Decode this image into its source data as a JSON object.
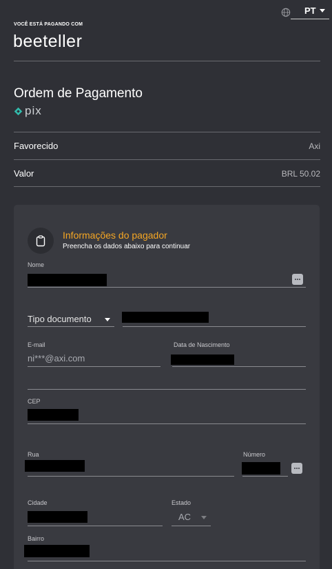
{
  "header": {
    "language": "PT",
    "paying_with_label": "VOCÊ ESTÁ PAGANDO COM",
    "brand": "beeteller"
  },
  "order": {
    "title": "Ordem de Pagamento",
    "payment_method": "pix",
    "rows": [
      {
        "label": "Favorecido",
        "value": "Axi"
      },
      {
        "label": "Valor",
        "value": "BRL 50.02"
      }
    ]
  },
  "payer": {
    "title": "Informações do pagador",
    "subtitle": "Preencha os dados abaixo para continuar",
    "fields": {
      "nome_label": "Nome",
      "tipo_documento_label": "Tipo documento",
      "email_label": "E-mail",
      "email_value": "ni***@axi.com",
      "nascimento_label": "Data de Nascimento",
      "cep_label": "CEP",
      "rua_label": "Rua",
      "numero_label": "Número",
      "cidade_label": "Cidade",
      "estado_label": "Estado",
      "estado_value": "AC",
      "bairro_label": "Bairro"
    }
  },
  "colors": {
    "background": "#2f3036",
    "card": "#393a40",
    "accent": "#f5a623",
    "pix": "#32bcad"
  }
}
